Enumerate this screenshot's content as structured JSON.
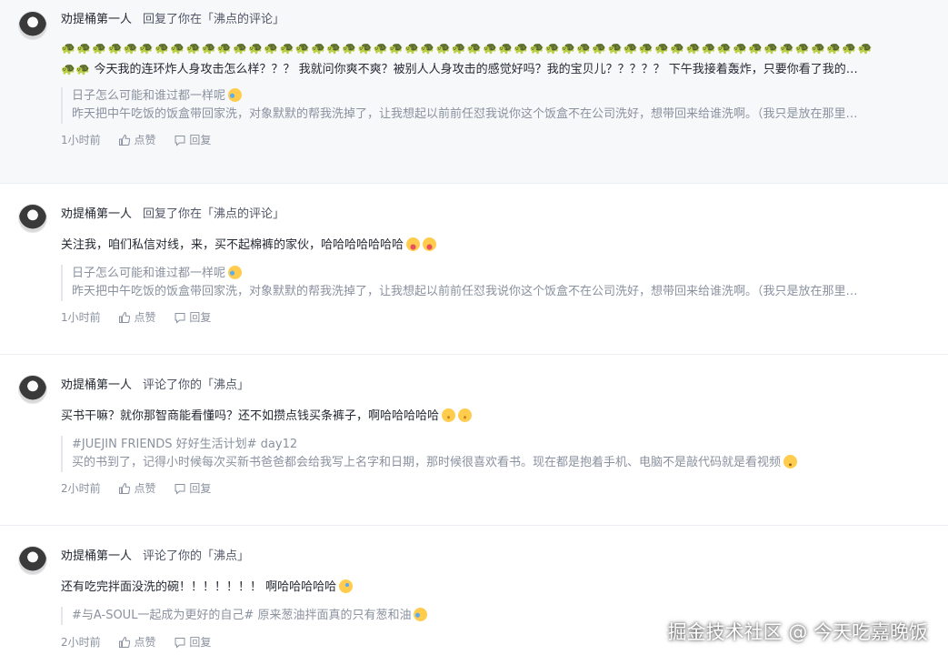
{
  "notifications": [
    {
      "author": "劝提桶第一人",
      "action": "回复了你在「沸点的评论」",
      "turtles": "🐢🐢🐢🐢🐢🐢🐢🐢🐢🐢🐢🐢🐢🐢🐢🐢🐢🐢🐢🐢🐢🐢🐢🐢🐢🐢🐢🐢🐢🐢🐢🐢🐢🐢🐢🐢🐢🐢🐢🐢🐢🐢🐢🐢🐢🐢🐢🐢🐢🐢🐢🐢",
      "content": "🐢🐢 今天我的连环炸人身攻击怎么样？？？ 我就问你爽不爽？被别人人身攻击的感觉好吗？我的宝贝儿？？？？？ 下午我接着轰炸，只要你看了我的…",
      "quote_title": "日子怎么可能和谁过都一样呢",
      "quote_body": "昨天把中午吃饭的饭盒带回家洗，对象默默的帮我洗掉了，让我想起以前前任怼我说你这个饭盒不在公司洗好，想带回来给谁洗啊。（我只是放在那里…",
      "time": "1小时前",
      "like": "点赞",
      "reply": "回复"
    },
    {
      "author": "劝提桶第一人",
      "action": "回复了你在「沸点的评论」",
      "content": "关注我，咱们私信对线，来，买不起棉裤的家伙，哈哈哈哈哈哈哈",
      "quote_title": "日子怎么可能和谁过都一样呢",
      "quote_body": "昨天把中午吃饭的饭盒带回家洗，对象默默的帮我洗掉了，让我想起以前前任怼我说你这个饭盒不在公司洗好，想带回来给谁洗啊。（我只是放在那里…",
      "time": "1小时前",
      "like": "点赞",
      "reply": "回复"
    },
    {
      "author": "劝提桶第一人",
      "action": "评论了你的「沸点」",
      "content": "买书干嘛？就你那智商能看懂吗？还不如攒点钱买条裤子，啊哈哈哈哈哈",
      "quote_title": "#JUEJIN FRIENDS 好好生活计划# day12",
      "quote_body": "买的书到了，记得小时候每次买新书爸爸都会给我写上名字和日期，那时候很喜欢看书。现在都是抱着手机、电脑不是敲代码就是看视频",
      "time": "2小时前",
      "like": "点赞",
      "reply": "回复"
    },
    {
      "author": "劝提桶第一人",
      "action": "评论了你的「沸点」",
      "content": "还有吃完拌面没洗的碗！！！！！！！ 啊哈哈哈哈哈",
      "quote_title": "#与A-SOUL一起成为更好的自己# 原来葱油拌面真的只有葱和油",
      "time": "2小时前",
      "like": "点赞",
      "reply": "回复"
    }
  ],
  "watermark": "掘金技术社区 @ 今天吃嘉晚饭",
  "icons": {
    "like": "thumbs-up-icon",
    "reply": "comment-icon"
  },
  "colors": {
    "highlight_bg": "#f7f8fa",
    "text_primary": "#252933",
    "text_muted": "#8a919f"
  }
}
